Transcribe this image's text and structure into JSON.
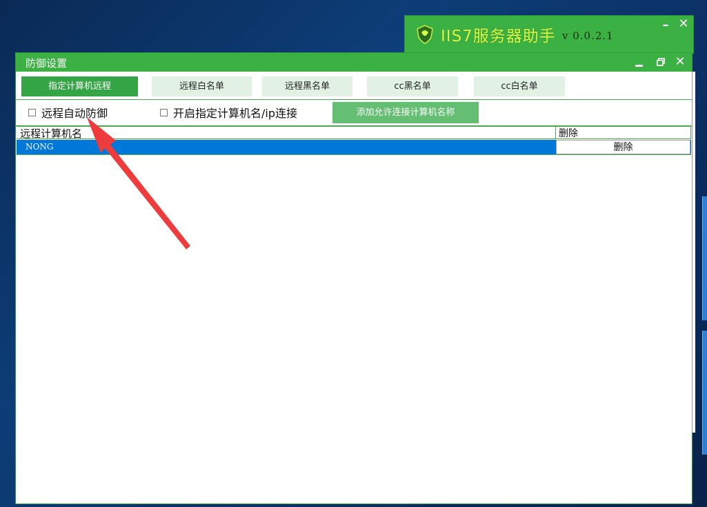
{
  "main_app": {
    "title": "IIS7服务器助手",
    "version": "v 0.0.2.1",
    "minimize_icon": "minimize-icon",
    "close_icon": "close-icon"
  },
  "dialog": {
    "title": "防御设置",
    "minimize_icon": "minimize-icon",
    "restore_icon": "restore-icon",
    "close_icon": "close-icon"
  },
  "tabs": [
    {
      "label": "指定计算机远程",
      "active": true
    },
    {
      "label": "远程白名单",
      "active": false
    },
    {
      "label": "远程黑名单",
      "active": false
    },
    {
      "label": "cc黑名单",
      "active": false
    },
    {
      "label": "cc白名单",
      "active": false
    }
  ],
  "options": {
    "auto_defense_label": "远程自动防御",
    "auto_defense_checked": false,
    "enable_whitelist_label": "开启指定计算机名/ip连接",
    "enable_whitelist_checked": false,
    "add_button_label": "添加允许连接计算机名称"
  },
  "grid": {
    "columns": [
      "远程计算机名",
      "删除"
    ],
    "rows": [
      {
        "name": "NONG",
        "action": "删除",
        "selected": true
      }
    ]
  },
  "colors": {
    "accent_green": "#3bb043",
    "selection_blue": "#0078d7",
    "annotation_red": "#ee3b3b"
  }
}
